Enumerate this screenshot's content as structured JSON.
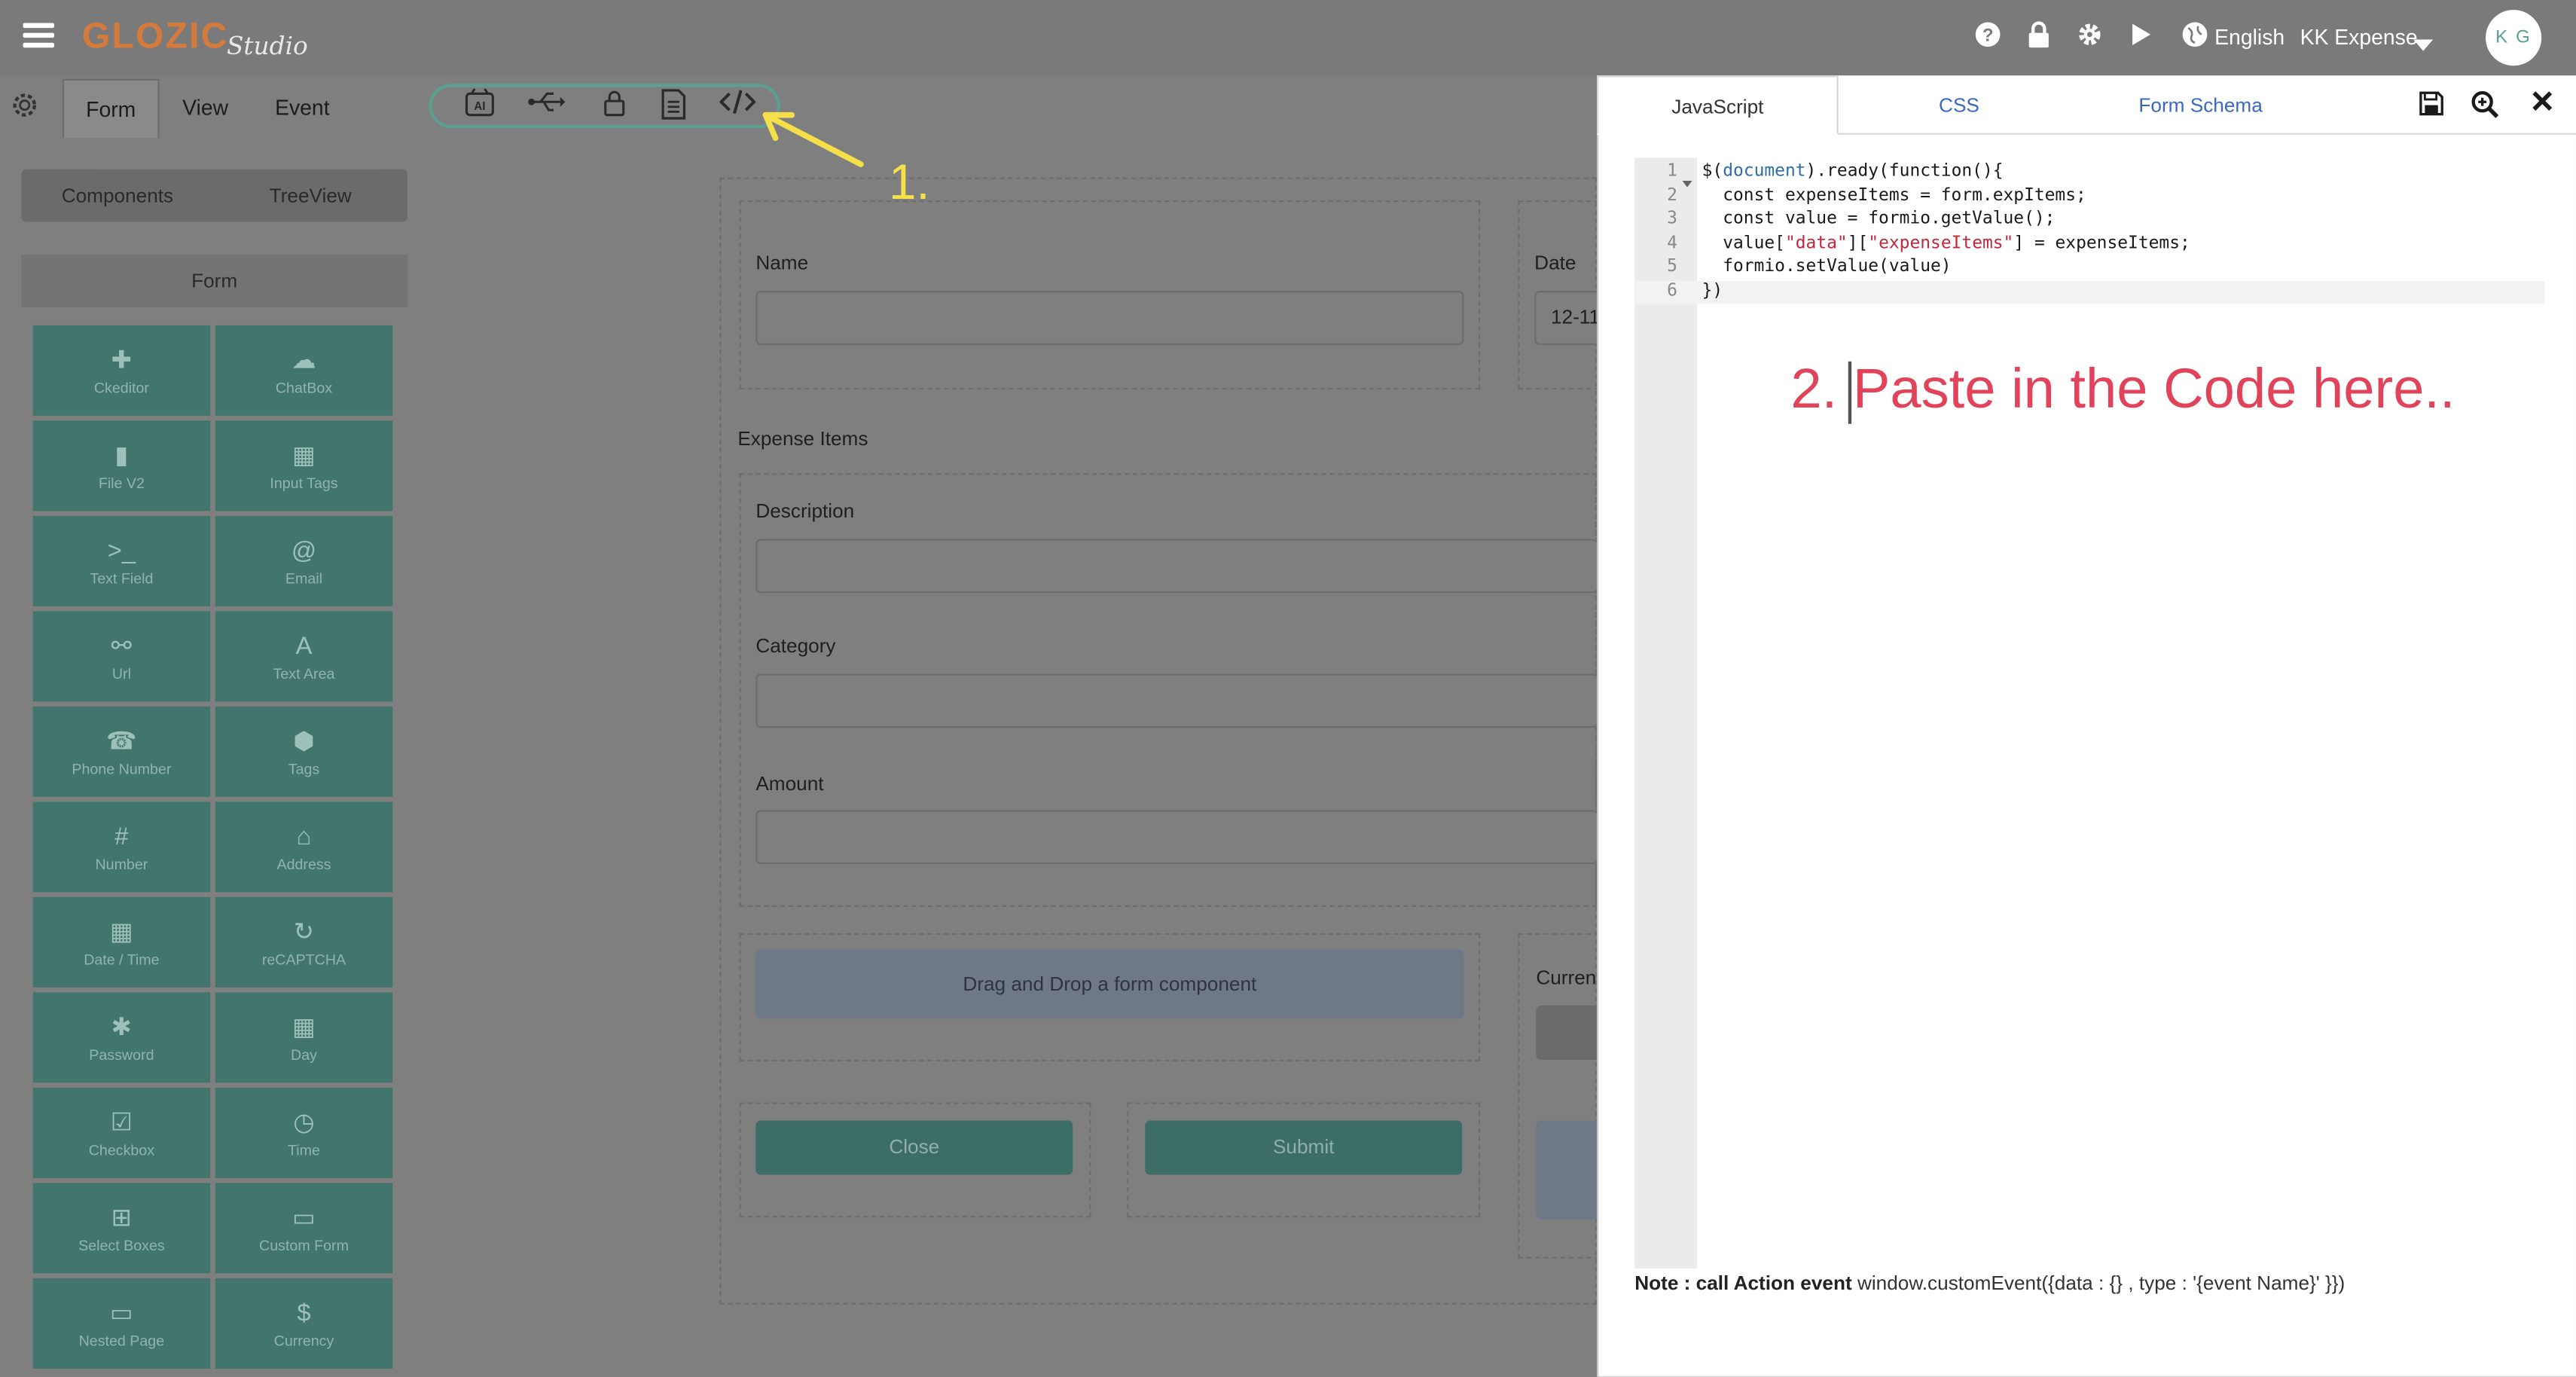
{
  "topbar": {
    "brand": "GLOZIC",
    "brand_sub": "Studio",
    "language": "English",
    "project": "KK Expense",
    "avatar_initials": "K G",
    "icons": [
      "help-icon",
      "lock-icon",
      "gear-icon",
      "play-icon",
      "globe-icon",
      "caret-down-icon"
    ]
  },
  "designer_tabs": [
    "Form",
    "View",
    "Event"
  ],
  "toolbar_icons": [
    "ai-icon",
    "usb-icon",
    "lock-icon",
    "document-icon",
    "code-icon"
  ],
  "sidebar": {
    "tabs": [
      "Components",
      "TreeView"
    ],
    "section": "Form",
    "components": [
      {
        "label": "Ckeditor",
        "icon": "✚"
      },
      {
        "label": "ChatBox",
        "icon": "☁"
      },
      {
        "label": "File V2",
        "icon": "▮"
      },
      {
        "label": "Input Tags",
        "icon": "▦"
      },
      {
        "label": "Text Field",
        "icon": ">_"
      },
      {
        "label": "Email",
        "icon": "@"
      },
      {
        "label": "Url",
        "icon": "⚯"
      },
      {
        "label": "Text Area",
        "icon": "A"
      },
      {
        "label": "Phone Number",
        "icon": "☎"
      },
      {
        "label": "Tags",
        "icon": "⬢"
      },
      {
        "label": "Number",
        "icon": "#"
      },
      {
        "label": "Address",
        "icon": "⌂"
      },
      {
        "label": "Date / Time",
        "icon": "▦"
      },
      {
        "label": "reCAPTCHA",
        "icon": "↻"
      },
      {
        "label": "Password",
        "icon": "✱"
      },
      {
        "label": "Day",
        "icon": "▦"
      },
      {
        "label": "Checkbox",
        "icon": "☑"
      },
      {
        "label": "Time",
        "icon": "◷"
      },
      {
        "label": "Select Boxes",
        "icon": "⊞"
      },
      {
        "label": "Custom Form",
        "icon": "▭"
      },
      {
        "label": "Nested Page",
        "icon": "▭"
      },
      {
        "label": "Currency",
        "icon": "$"
      }
    ]
  },
  "form": {
    "name_label": "Name",
    "date_label": "Date",
    "date_value": "12-11",
    "expense_items_label": "Expense Items",
    "description_label": "Description",
    "category_label": "Category",
    "amount_label": "Amount",
    "dnd_text": "Drag and Drop a form component",
    "currency_label": "Curren",
    "close_button": "Close",
    "submit_button": "Submit"
  },
  "panel": {
    "tabs": [
      "JavaScript",
      "CSS",
      "Form Schema"
    ],
    "active_tab": "JavaScript",
    "icons": [
      "save-icon",
      "zoom-icon",
      "close-icon"
    ],
    "line_numbers": [
      "1",
      "2",
      "3",
      "4",
      "5",
      "6"
    ],
    "code": {
      "l1_a": "$(",
      "l1_b": "document",
      "l1_c": ").ready(function(){",
      "l2": "  const expenseItems = form.expItems;",
      "l3": "  const value = formio.getValue();",
      "l4_a": "  value[",
      "l4_b": "\"data\"",
      "l4_c": "][",
      "l4_d": "\"expenseItems\"",
      "l4_e": "] = expenseItems;",
      "l5": "  formio.setValue(value)",
      "l6": "})"
    },
    "note_bold": "Note : call Action event",
    "note_text": " window.customEvent({data : {} , type : '{event Name}' }})"
  },
  "annotations": {
    "step1": "1.",
    "step2": "2. Paste in the Code here.."
  }
}
